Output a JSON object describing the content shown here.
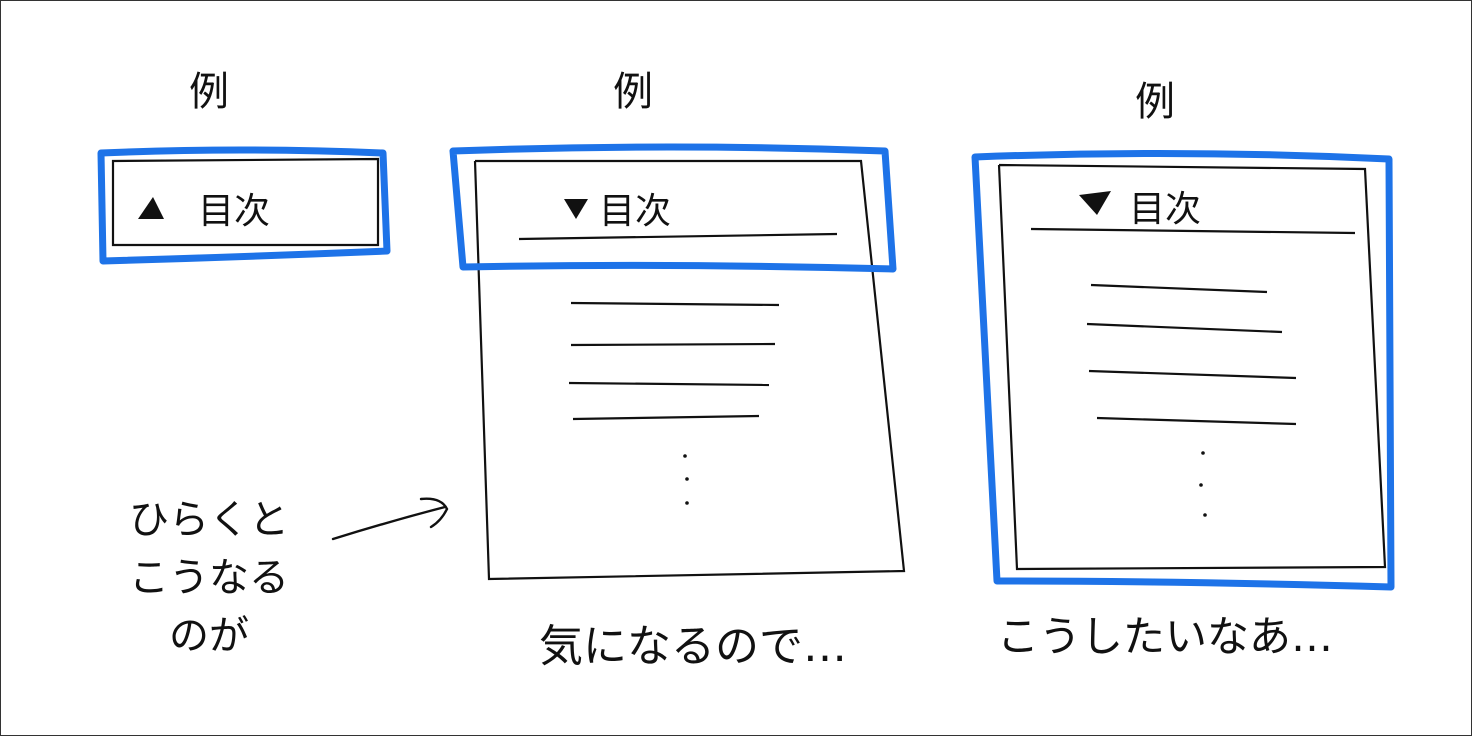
{
  "panels": [
    {
      "heading": "例",
      "toc_title": "目次",
      "state": "collapsed",
      "highlight_color": "#1e73e8"
    },
    {
      "heading": "例",
      "toc_title": "目次",
      "state": "expanded",
      "highlight_color": "#1e73e8",
      "caption": "気になるので…"
    },
    {
      "heading": "例",
      "toc_title": "目次",
      "state": "expanded",
      "highlight_color": "#1e73e8",
      "caption": "こうしたいなあ…"
    }
  ],
  "note": {
    "lines": [
      "ひらくと",
      "こうなる",
      "のが"
    ]
  },
  "colors": {
    "ink": "#111111",
    "highlight": "#1e73e8",
    "background": "#ffffff"
  },
  "icons": {
    "arrow": "arrow-right-icon",
    "disclosure": "triangle-icon"
  }
}
